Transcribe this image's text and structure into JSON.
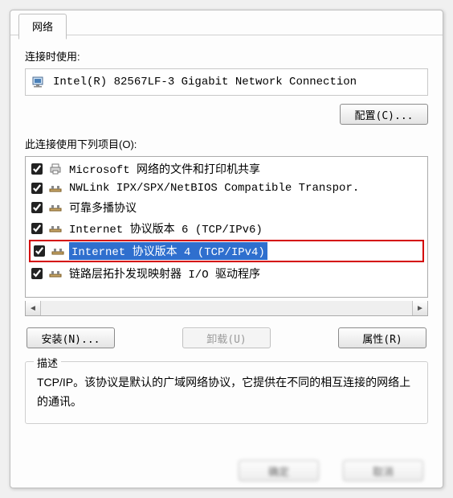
{
  "tab": {
    "label": "网络"
  },
  "connect_using": {
    "label": "连接时使用:",
    "adapter": "Intel(R) 82567LF-3 Gigabit Network Connection"
  },
  "configure_btn": "配置(C)...",
  "items_label": "此连接使用下列项目(O):",
  "items": [
    {
      "checked": true,
      "label": "Microsoft 网络的文件和打印机共享",
      "icon": "printer"
    },
    {
      "checked": true,
      "label": "NWLink IPX/SPX/NetBIOS Compatible Transpor.",
      "icon": "proto"
    },
    {
      "checked": true,
      "label": "可靠多播协议",
      "icon": "proto"
    },
    {
      "checked": true,
      "label": "Internet 协议版本 6 (TCP/IPv6)",
      "icon": "proto"
    },
    {
      "checked": true,
      "label": "Internet 协议版本 4 (TCP/IPv4)",
      "icon": "proto",
      "selected": true,
      "highlighted": true
    },
    {
      "checked": true,
      "label": "链路层拓扑发现映射器 I/O 驱动程序",
      "icon": "proto"
    }
  ],
  "buttons": {
    "install": "安装(N)...",
    "uninstall": "卸载(U)",
    "properties": "属性(R)"
  },
  "description": {
    "title": "描述",
    "text": "TCP/IP。该协议是默认的广域网络协议，它提供在不同的相互连接的网络上的通讯。"
  },
  "dialog_buttons": {
    "ok": "确定",
    "cancel": "取消"
  }
}
